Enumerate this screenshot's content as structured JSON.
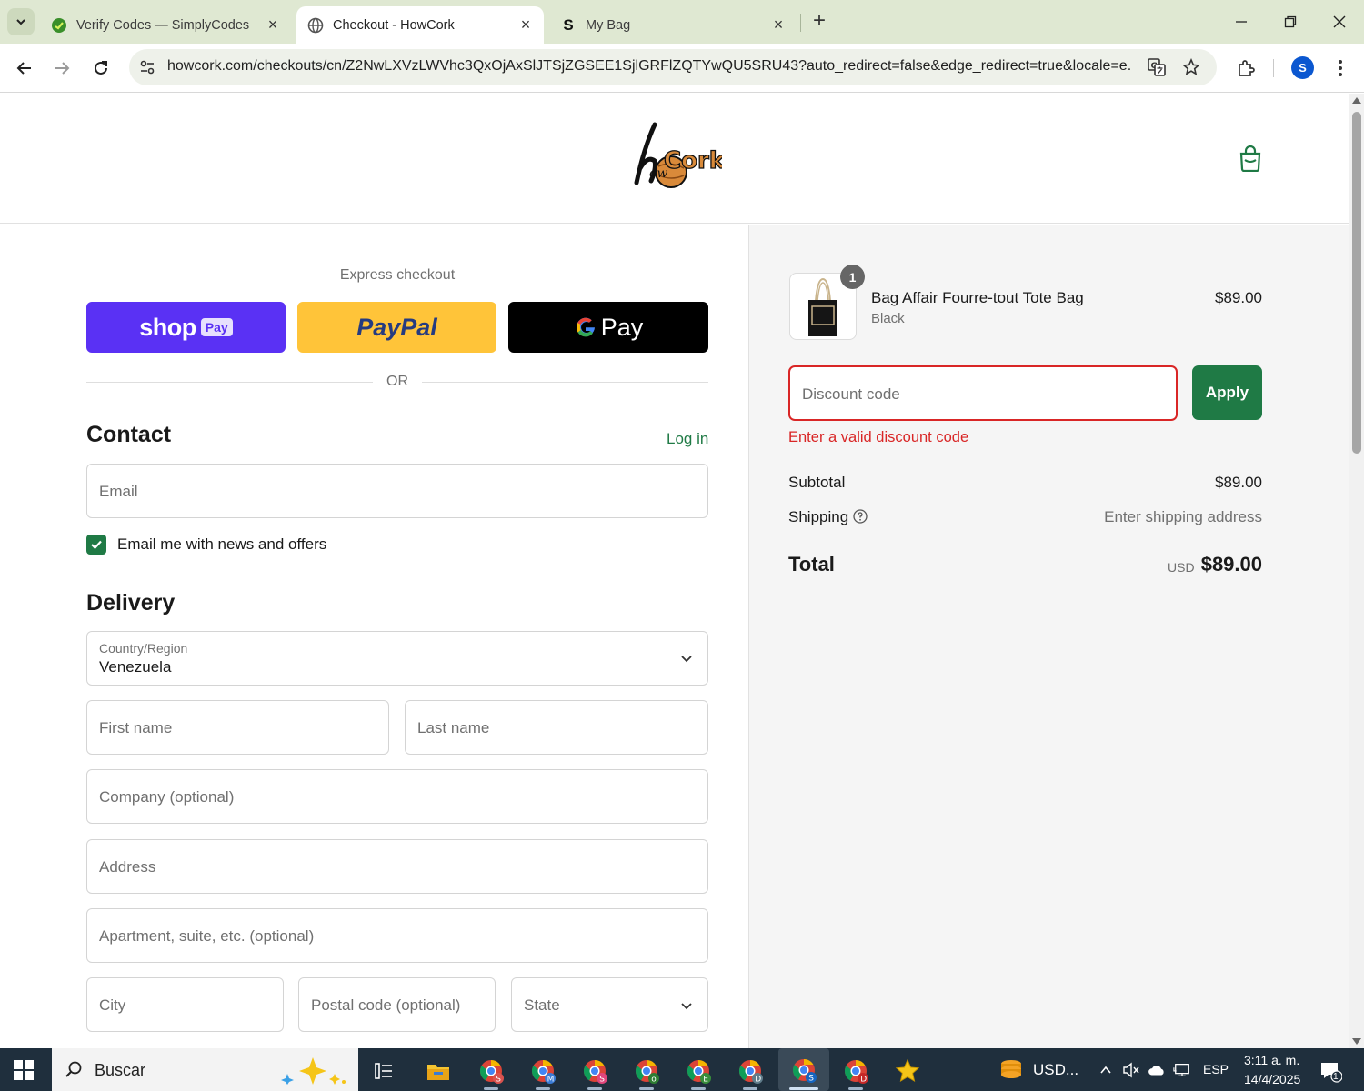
{
  "browser": {
    "tabs": [
      {
        "title": "Verify Codes — SimplyCodes",
        "active": false
      },
      {
        "title": "Checkout - HowCork",
        "active": true
      },
      {
        "title": "My Bag",
        "active": false
      }
    ],
    "url": "howcork.com/checkouts/cn/Z2NwLXVzLWVhc3QxOjAxSlJTSjZGSEE1SjlGRFlZQTYwQU5SRU43?auto_redirect=false&edge_redirect=true&locale=e...",
    "profile_initial": "S"
  },
  "checkout": {
    "express_label": "Express checkout",
    "shop_pay": {
      "word": "shop",
      "badge": "Pay"
    },
    "paypal_label": "PayPal",
    "gpay_label": "Pay",
    "or_label": "OR",
    "contact": {
      "title": "Contact",
      "login_label": "Log in",
      "email_placeholder": "Email",
      "newsletter_label": "Email me with news and offers",
      "newsletter_checked": true
    },
    "delivery": {
      "title": "Delivery",
      "country_label": "Country/Region",
      "country_value": "Venezuela",
      "first_name": "First name",
      "last_name": "Last name",
      "company": "Company (optional)",
      "address": "Address",
      "apartment": "Apartment, suite, etc. (optional)",
      "city": "City",
      "postal": "Postal code (optional)",
      "state": "State"
    }
  },
  "summary": {
    "product": {
      "name": "Bag Affair Fourre-tout Tote Bag",
      "variant": "Black",
      "price": "$89.00",
      "quantity": "1"
    },
    "discount": {
      "placeholder": "Discount code",
      "apply_label": "Apply",
      "error": "Enter a valid discount code"
    },
    "subtotal_label": "Subtotal",
    "subtotal_value": "$89.00",
    "shipping_label": "Shipping",
    "shipping_value": "Enter shipping address",
    "total_label": "Total",
    "total_currency": "USD",
    "total_value": "$89.00"
  },
  "taskbar": {
    "search_label": "Buscar",
    "tray_currency": "USD...",
    "language": "ESP",
    "time": "3:11 a. m.",
    "date": "14/4/2025",
    "notification_count": "1"
  },
  "colors": {
    "accent_green": "#1f7a45",
    "error_red": "#d92626",
    "shop_pay_purple": "#5a31f4",
    "paypal_yellow": "#ffc439",
    "tabstrip": "#dfe8d2"
  }
}
